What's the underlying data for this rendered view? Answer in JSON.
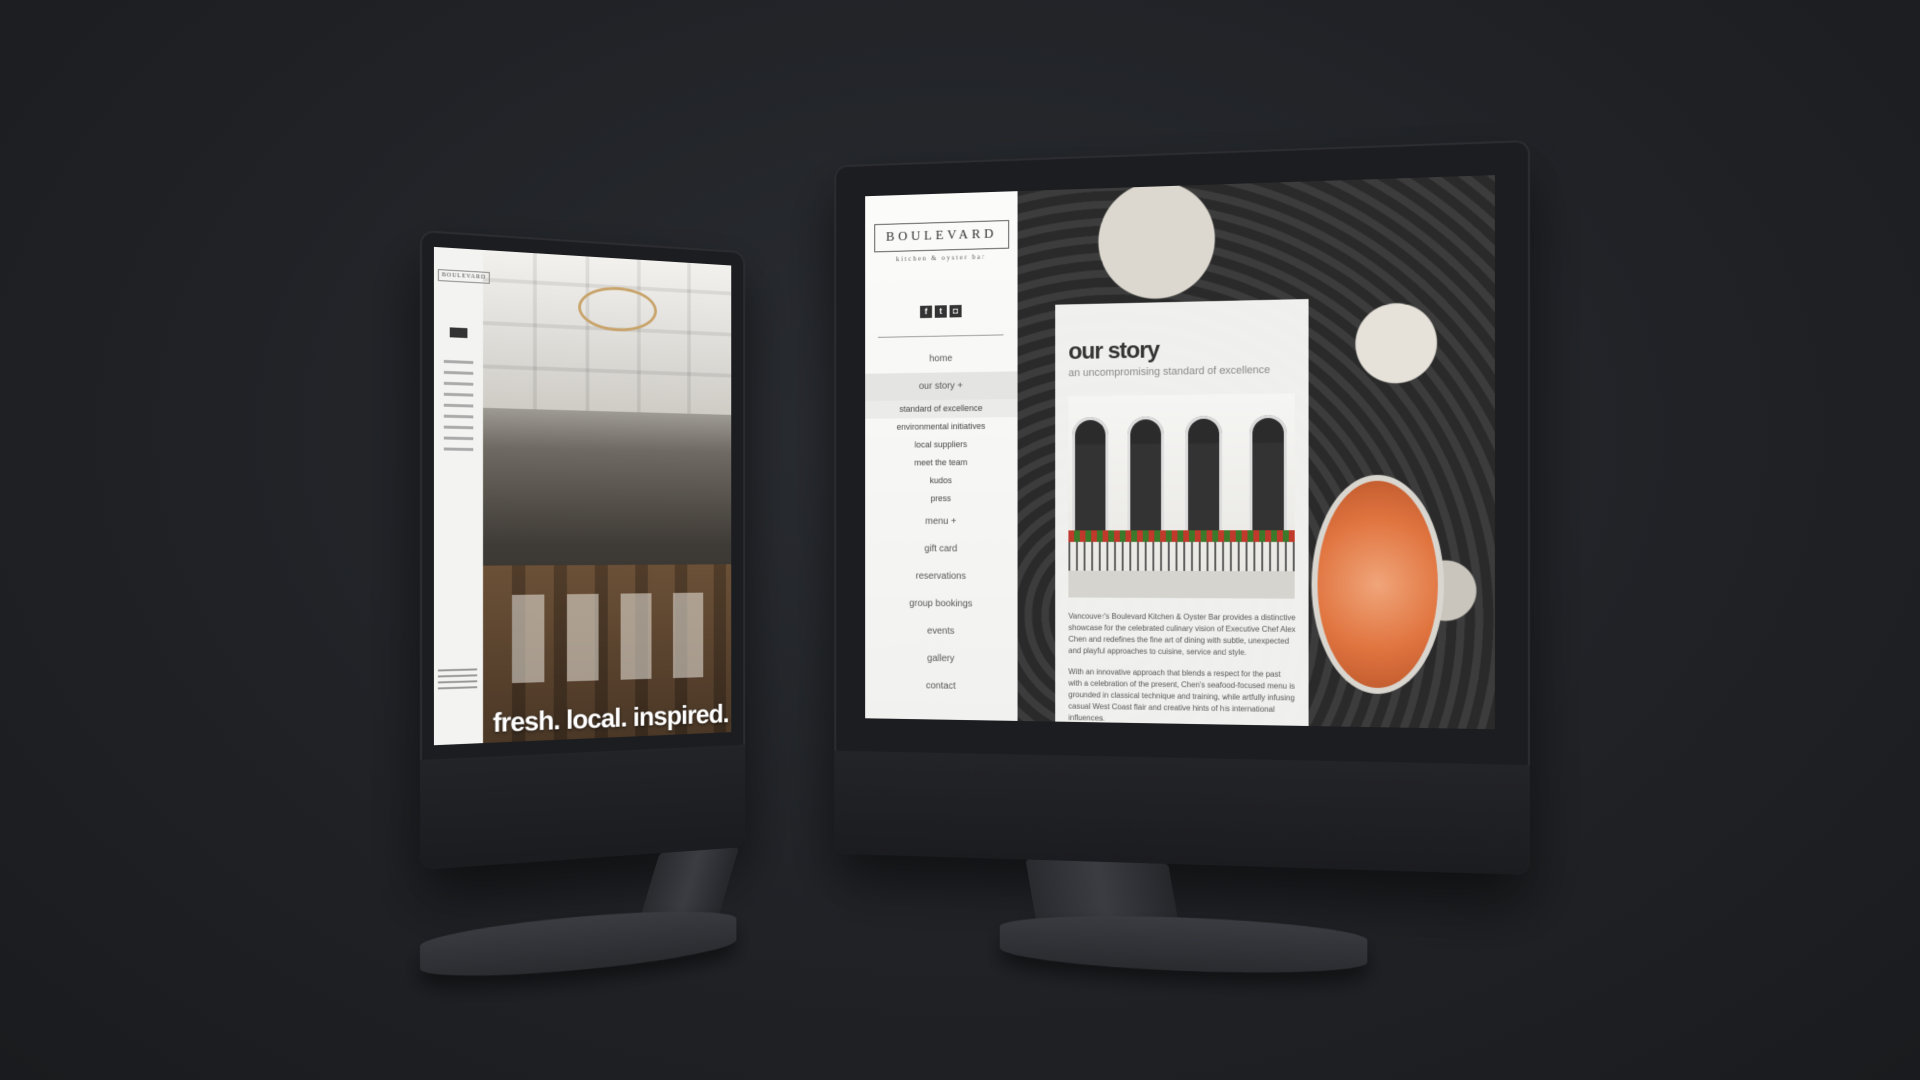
{
  "left_site": {
    "logo": "BOULEVARD",
    "headline": "fresh. local. inspired."
  },
  "right_site": {
    "logo": "BOULEVARD",
    "tagline": "kitchen & oyster bar",
    "social": [
      {
        "icon": "facebook-icon",
        "glyph": "f"
      },
      {
        "icon": "twitter-icon",
        "glyph": "t"
      },
      {
        "icon": "instagram-icon",
        "glyph": "◘"
      }
    ],
    "nav": [
      {
        "label": "home"
      },
      {
        "label": "our story +",
        "active": true
      },
      {
        "label": "menu +"
      },
      {
        "label": "gift card"
      },
      {
        "label": "reservations"
      },
      {
        "label": "group bookings"
      },
      {
        "label": "events"
      },
      {
        "label": "gallery"
      },
      {
        "label": "contact"
      }
    ],
    "subnav": [
      {
        "label": "standard of excellence",
        "selected": true
      },
      {
        "label": "environmental initiatives"
      },
      {
        "label": "local suppliers"
      },
      {
        "label": "meet the team"
      },
      {
        "label": "kudos"
      },
      {
        "label": "press"
      }
    ],
    "page_title": "our story",
    "page_subtitle": "an uncompromising standard of excellence",
    "body": [
      "Vancouver's Boulevard Kitchen & Oyster Bar provides a distinctive showcase for the celebrated culinary vision of Executive Chef Alex Chen and redefines the fine art of dining with subtle, unexpected and playful approaches to cuisine, service and style.",
      "With an innovative approach that blends a respect for the past with a celebration of the present, Chen's seafood-focused menu is grounded in classical technique and training, while artfully infusing casual West Coast flair and creative hints of his international influences."
    ]
  },
  "colors": {
    "background": "#202226",
    "bezel": "#1c1d20",
    "sidebar": "#f3f3f1",
    "caviar": "#e0743f"
  }
}
